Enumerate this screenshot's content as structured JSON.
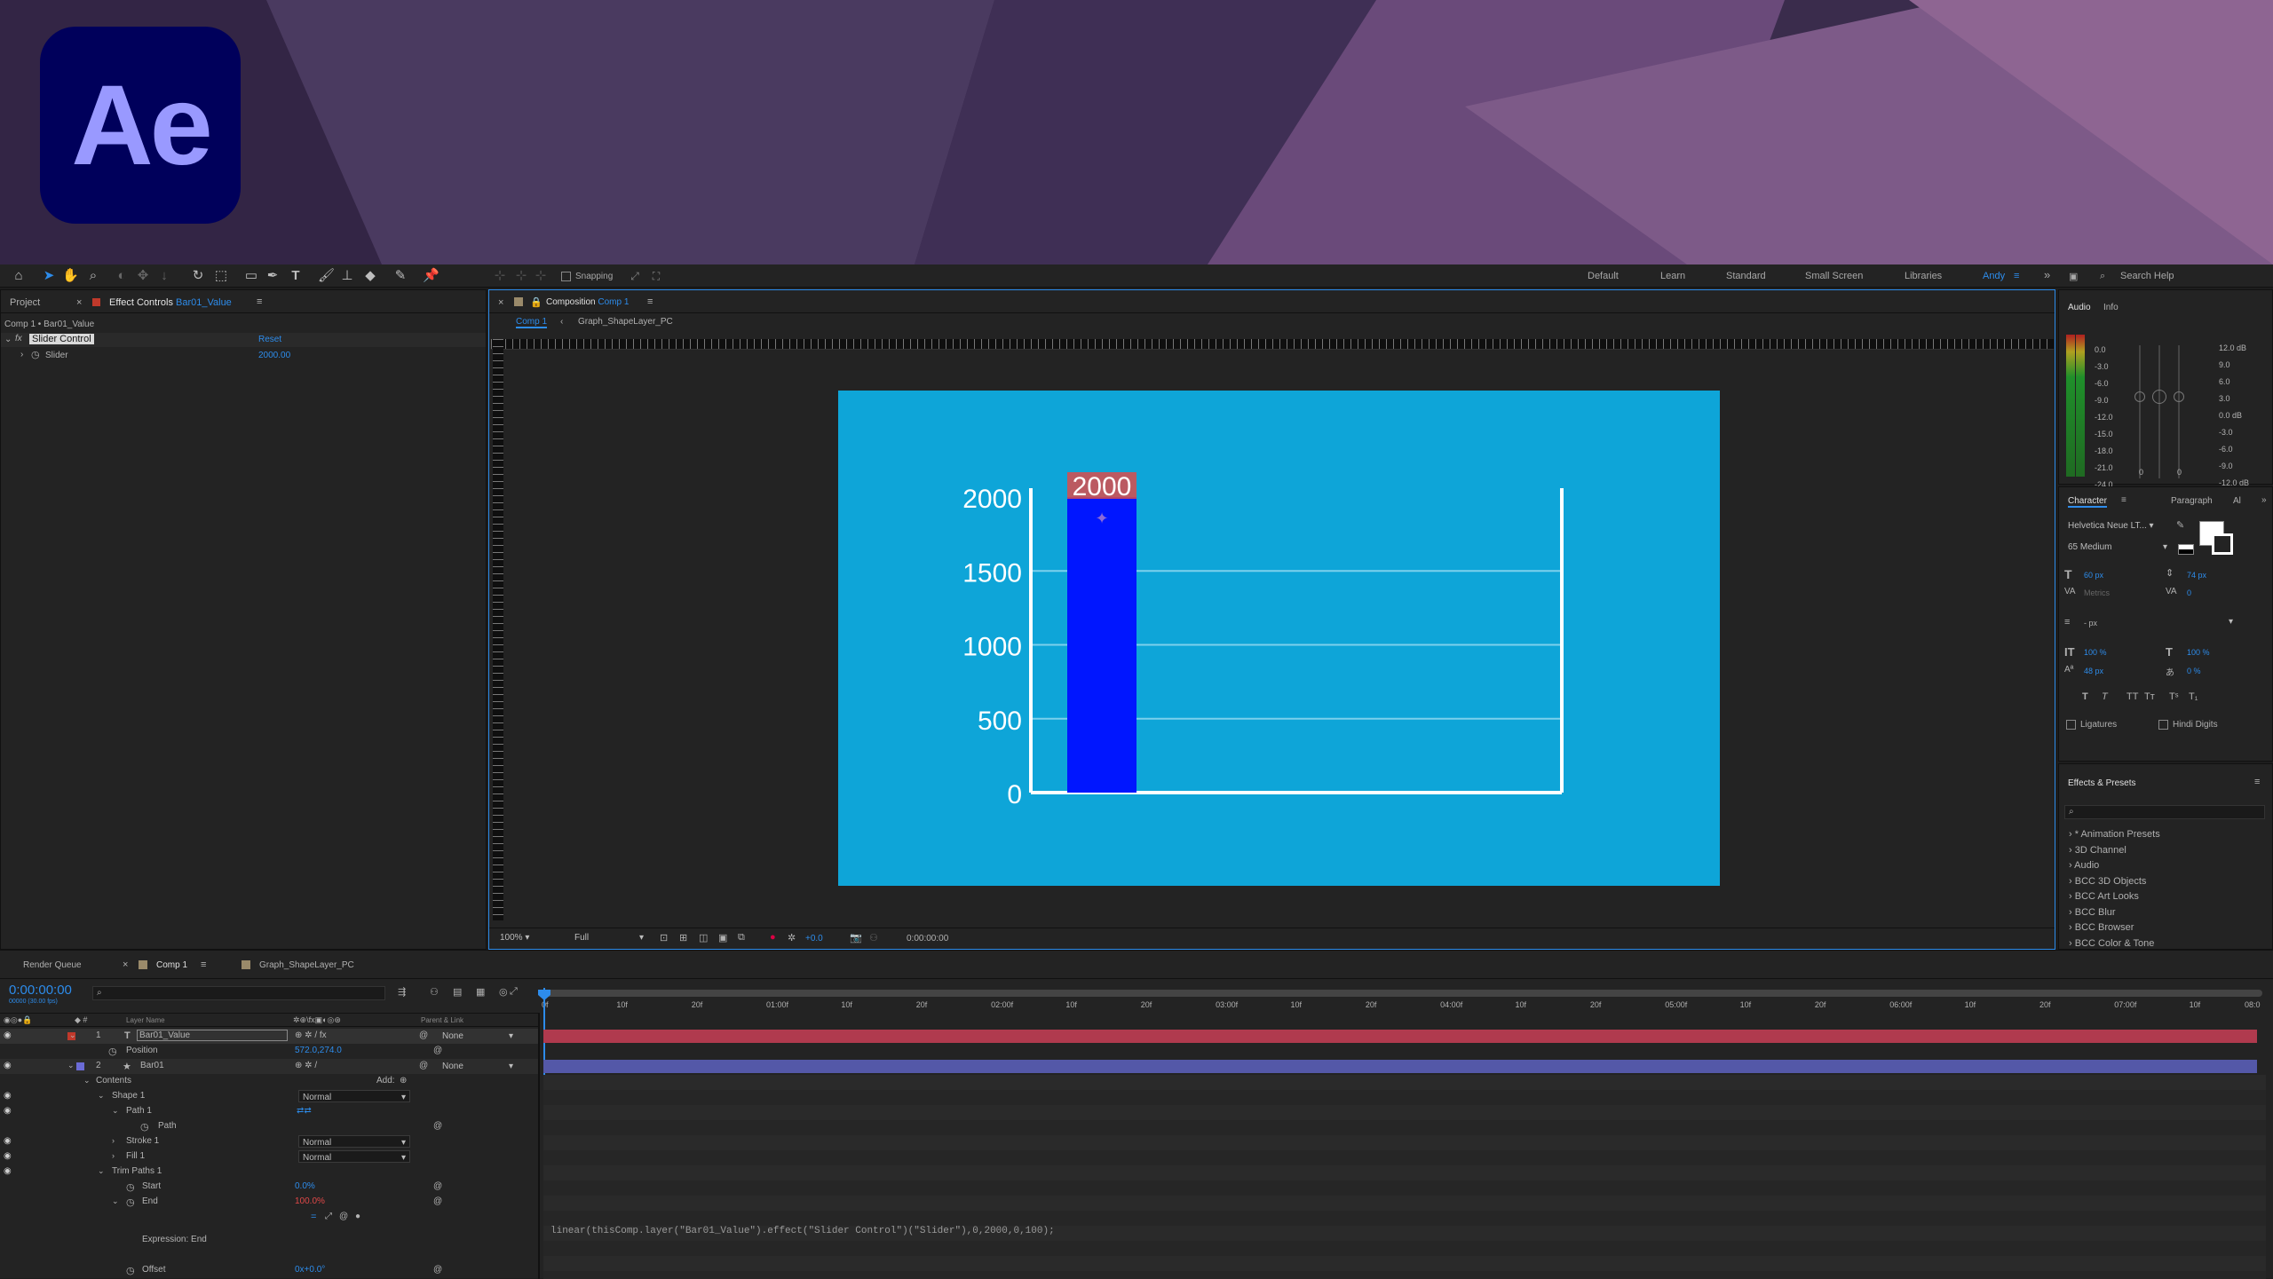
{
  "logo": {
    "text": "Ae"
  },
  "workspaces": [
    "Default",
    "Learn",
    "Standard",
    "Small Screen",
    "Libraries",
    "Andy"
  ],
  "search_help": {
    "placeholder": "Search Help"
  },
  "snapping_label": "Snapping",
  "left_panel": {
    "tab_project": "Project",
    "tab_effect_controls": "Effect Controls",
    "tab_effect_layer": "Bar01_Value",
    "breadcrumb": "Comp 1 • Bar01_Value",
    "effect_name": "Slider Control",
    "reset_label": "Reset",
    "property_name": "Slider",
    "property_value": "2000.00"
  },
  "composition": {
    "tab_label": "Composition",
    "tab_name": "Comp 1",
    "crumb_1": "Comp 1",
    "crumb_2": "Graph_ShapeLayer_PC",
    "zoom": "100%",
    "resolution": "Full",
    "exposure": "+0.0",
    "timecode": "0:00:00:00"
  },
  "chart_data": {
    "type": "bar",
    "categories": [
      ""
    ],
    "values": [
      2000
    ],
    "bar_label": "2000",
    "y_ticks": [
      "2000",
      "1500",
      "1000",
      "500",
      "0"
    ],
    "ylim": [
      0,
      2000
    ],
    "grid": true,
    "colors": {
      "background": "#0ea5d8",
      "bar": "#0016ff",
      "axis": "#ffffff",
      "grid": "#7cd0ec"
    }
  },
  "audio_panel": {
    "tab_audio": "Audio",
    "tab_info": "Info",
    "left_scale": [
      "0.0",
      "-3.0",
      "-6.0",
      "-9.0",
      "-12.0",
      "-15.0",
      "-18.0",
      "-21.0",
      "-24.0"
    ],
    "right_scale": [
      "12.0 dB",
      "9.0",
      "6.0",
      "3.0",
      "0.0 dB",
      "-3.0",
      "-6.0",
      "-9.0",
      "-12.0 dB"
    ],
    "bottom_left": "0",
    "bottom_right": "0"
  },
  "character_panel": {
    "tab_character": "Character",
    "tab_paragraph": "Paragraph",
    "tab_al": "Al",
    "font": "Helvetica Neue LT...",
    "style": "65 Medium",
    "size": "60 px",
    "leading": "74 px",
    "kerning": "Metrics",
    "tracking": "0",
    "stroke": "- px",
    "vscale": "100 %",
    "hscale": "100 %",
    "baseline": "48 px",
    "tsume": "0 %",
    "ligatures": "Ligatures",
    "hindi": "Hindi Digits"
  },
  "effects_presets": {
    "title": "Effects & Presets",
    "items": [
      "* Animation Presets",
      "3D Channel",
      "Audio",
      "BCC 3D Objects",
      "BCC Art Looks",
      "BCC Blur",
      "BCC Browser",
      "BCC Color & Tone"
    ]
  },
  "timeline": {
    "tab_render_queue": "Render Queue",
    "tab_comp": "Comp 1",
    "tab_graph": "Graph_ShapeLayer_PC",
    "timecode": "0:00:00:00",
    "fps": "00000 (30.00 fps)",
    "header_layer_name": "Layer Name",
    "header_parent": "Parent & Link",
    "ruler": [
      "0f",
      "10f",
      "20f",
      "01:00f",
      "10f",
      "20f",
      "02:00f",
      "10f",
      "20f",
      "03:00f",
      "10f",
      "20f",
      "04:00f",
      "10f",
      "20f",
      "05:00f",
      "10f",
      "20f",
      "06:00f",
      "10f",
      "20f",
      "07:00f",
      "10f",
      "08:0"
    ],
    "layers": [
      {
        "num": "1",
        "name": "Bar01_Value",
        "parent": "None"
      },
      {
        "num": "2",
        "name": "Bar01",
        "parent": "None"
      }
    ],
    "position_label": "Position",
    "position_value": "572.0,274.0",
    "contents": "Contents",
    "add_label": "Add:",
    "shape1": "Shape 1",
    "path1": "Path 1",
    "path": "Path",
    "stroke1": "Stroke 1",
    "fill1": "Fill 1",
    "trim1": "Trim Paths 1",
    "start": "Start",
    "start_value": "0.0%",
    "end": "End",
    "end_value": "100.0%",
    "expr_label": "Expression: End",
    "offset": "Offset",
    "offset_value": "0x+0.0°",
    "blend_normal": "Normal",
    "expression": "linear(thisComp.layer(\"Bar01_Value\").effect(\"Slider Control\")(\"Slider\"),0,2000,0,100);"
  }
}
